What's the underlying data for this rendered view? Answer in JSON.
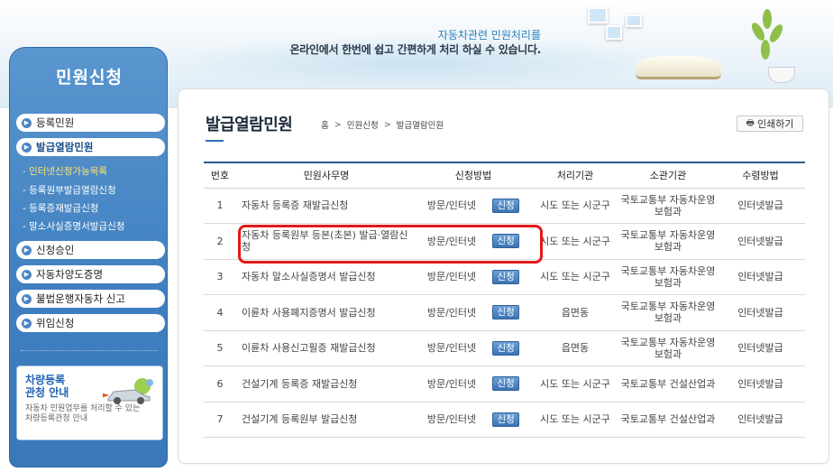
{
  "banner": {
    "line1": "자동차관련 민원처리를",
    "line2": "온라인에서 한번에 쉽고 간편하게 처리 하실 수 있습니다."
  },
  "sidebar": {
    "title": "민원신청",
    "items": [
      {
        "label": "등록민원"
      },
      {
        "label": "발급열람민원"
      },
      {
        "label": "신청승인"
      },
      {
        "label": "자동차양도증명"
      },
      {
        "label": "불법운행자동차 신고"
      },
      {
        "label": "위임신청"
      }
    ],
    "subitems": [
      {
        "label": "- 인터넷신청가능목록"
      },
      {
        "label": "- 등록원부발급열람신청"
      },
      {
        "label": "- 등록증재발급신청"
      },
      {
        "label": "- 말소사실증명서발급신청"
      }
    ],
    "promo": {
      "title_line1": "차량등록",
      "title_line2": "관청 안내",
      "desc_line1": "자동차 민원업무를 처리할 수 있는",
      "desc_line2": "차량등록관청 안내"
    }
  },
  "page": {
    "title": "발급열람민원",
    "breadcrumb": [
      "홈",
      "민원신청",
      "발급열람민원"
    ],
    "breadcrumb_sep": ">",
    "print_label": "인쇄하기"
  },
  "table": {
    "headers": [
      "번호",
      "민원사무명",
      "신청방법",
      "처리기관",
      "소관기관",
      "수령방법"
    ],
    "apply_label": "신청",
    "rows": [
      {
        "no": "1",
        "name": "자동차 등록증 재발급신청",
        "method": "방문/인터넷",
        "proc": "시도 또는 시군구",
        "org": "국토교통부 자동차운영보험과",
        "recv": "인터넷발급"
      },
      {
        "no": "2",
        "name": "자동차 등록원부 등본(초본) 발급·열람신청",
        "method": "방문/인터넷",
        "proc": "시도 또는 시군구",
        "org": "국토교통부 자동차운영보험과",
        "recv": "인터넷발급"
      },
      {
        "no": "3",
        "name": "자동차 말소사실증명서 발급신청",
        "method": "방문/인터넷",
        "proc": "시도 또는 시군구",
        "org": "국토교통부 자동차운영보험과",
        "recv": "인터넷발급"
      },
      {
        "no": "4",
        "name": "이륜차 사용폐지증명서 발급신청",
        "method": "방문/인터넷",
        "proc": "읍면동",
        "org": "국토교통부 자동차운영보험과",
        "recv": "인터넷발급"
      },
      {
        "no": "5",
        "name": "이륜차 사용신고필증 재발급신청",
        "method": "방문/인터넷",
        "proc": "읍면동",
        "org": "국토교통부 자동차운영보험과",
        "recv": "인터넷발급"
      },
      {
        "no": "6",
        "name": "건설기계 등록증 재발급신청",
        "method": "방문/인터넷",
        "proc": "시도 또는 시군구",
        "org": "국토교통부 건설산업과",
        "recv": "인터넷발급"
      },
      {
        "no": "7",
        "name": "건설기계 등록원부 발급신청",
        "method": "방문/인터넷",
        "proc": "시도 또는 시군구",
        "org": "국토교통부 건설산업과",
        "recv": "인터넷발급"
      }
    ]
  },
  "colors": {
    "sidebar": "#3f7fc0",
    "accent": "#2c5a91",
    "highlight": "#e21a1a",
    "apply_button": "#3c73b2"
  },
  "icons": [
    "printer-icon",
    "bullet-arrow-icon",
    "car-icon"
  ]
}
